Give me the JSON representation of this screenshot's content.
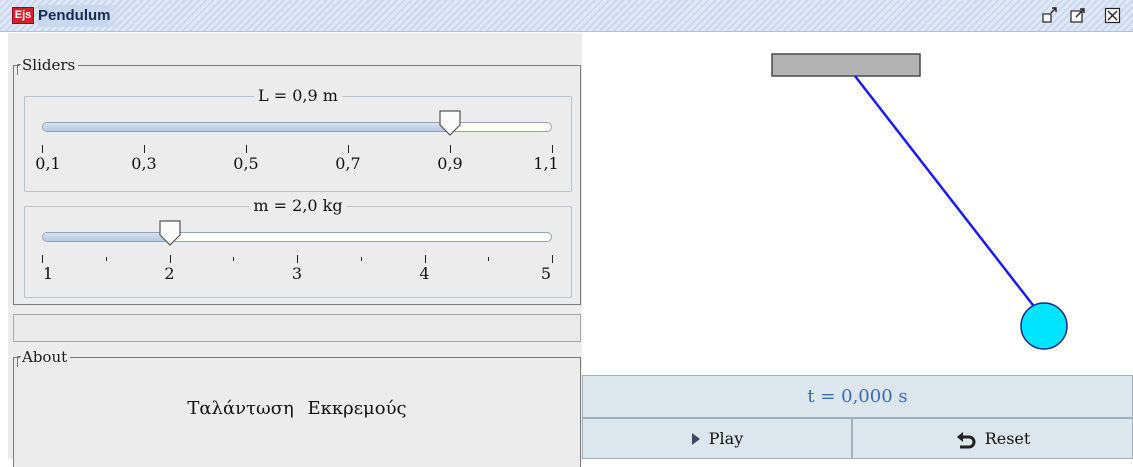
{
  "window": {
    "title": "Pendulum",
    "logo_text": "Ejs",
    "controls": [
      "restore-icon",
      "detach-icon",
      "close-icon"
    ]
  },
  "sliders_panel": {
    "title": "Sliders",
    "length_slider": {
      "label": "L = 0,9 m",
      "value": 0.9,
      "min": 0.1,
      "max": 1.1,
      "tick_labels": [
        "0,1",
        "0,3",
        "0,5",
        "0,7",
        "0,9",
        "1,1"
      ]
    },
    "mass_slider": {
      "label": "m = 2,0 kg",
      "value": 2.0,
      "min": 1,
      "max": 5,
      "tick_labels": [
        "1",
        "2",
        "3",
        "4",
        "5"
      ]
    }
  },
  "about_panel": {
    "title": "About",
    "text": "Ταλάντωση Εκκρεμούς"
  },
  "simulation": {
    "bob_color": "#00e5ff",
    "rod_color": "#1a1aff",
    "support_color": "#b3b3b3"
  },
  "time_display": "t = 0,000 s",
  "buttons": {
    "play": "Play",
    "reset": "Reset"
  }
}
